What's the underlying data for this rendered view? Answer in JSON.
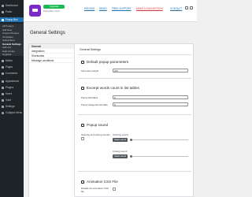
{
  "sidebar": {
    "items": [
      {
        "label": "Dashboard"
      },
      {
        "label": "Posts"
      },
      {
        "label": "Popup Box"
      },
      {
        "label": "Media"
      },
      {
        "label": "Pages"
      },
      {
        "label": "Comments"
      },
      {
        "label": "Appearance"
      },
      {
        "label": "Plugins"
      },
      {
        "label": "Users"
      },
      {
        "label": "Tools"
      },
      {
        "label": "Settings"
      },
      {
        "label": "Collapse Menu"
      }
    ],
    "submenu": [
      "All Popups",
      "Add New",
      "Custom Popups",
      "Templates",
      "Subscribers",
      "General Settings",
      "Add-ons",
      "Help Center",
      "Upgrade"
    ]
  },
  "header": {
    "upgrade_label": "Upgrade",
    "version_text": "Popup Box v.3.0.0",
    "links": {
      "pricing": "PRICING",
      "demo": "DEMO",
      "free_support": "FREE SUPPORT",
      "make_a_suggestion": "MAKE A SUGGESTION",
      "contact": "CONTACT"
    }
  },
  "page_title": "General Settings",
  "tabs": [
    "General",
    "Integrations",
    "Shortcodes",
    "Message conditions"
  ],
  "content": {
    "heading": "General Settings",
    "default_params": {
      "title": "Default popup parameters",
      "fields": [
        {
          "label": "Tab button height",
          "value": "100"
        }
      ]
    },
    "excerpt_words": {
      "title": "Excerpt words count in list tables",
      "fields": [
        {
          "label": "Popup list tables",
          "value": "5"
        },
        {
          "label": "Popup categories list table",
          "value": "5"
        }
      ]
    },
    "popup_sound": {
      "title": "Popup sound",
      "opening_label": "Opening and closing sounds",
      "opening_sound_label": "Opening sound",
      "closing_sound_label": "Closing sound",
      "select_sound_label": "Select sound",
      "remove_label": "Remove"
    },
    "animation": {
      "title": "Animation CSS File",
      "field_label": "Disable the Animation CSS file"
    }
  }
}
